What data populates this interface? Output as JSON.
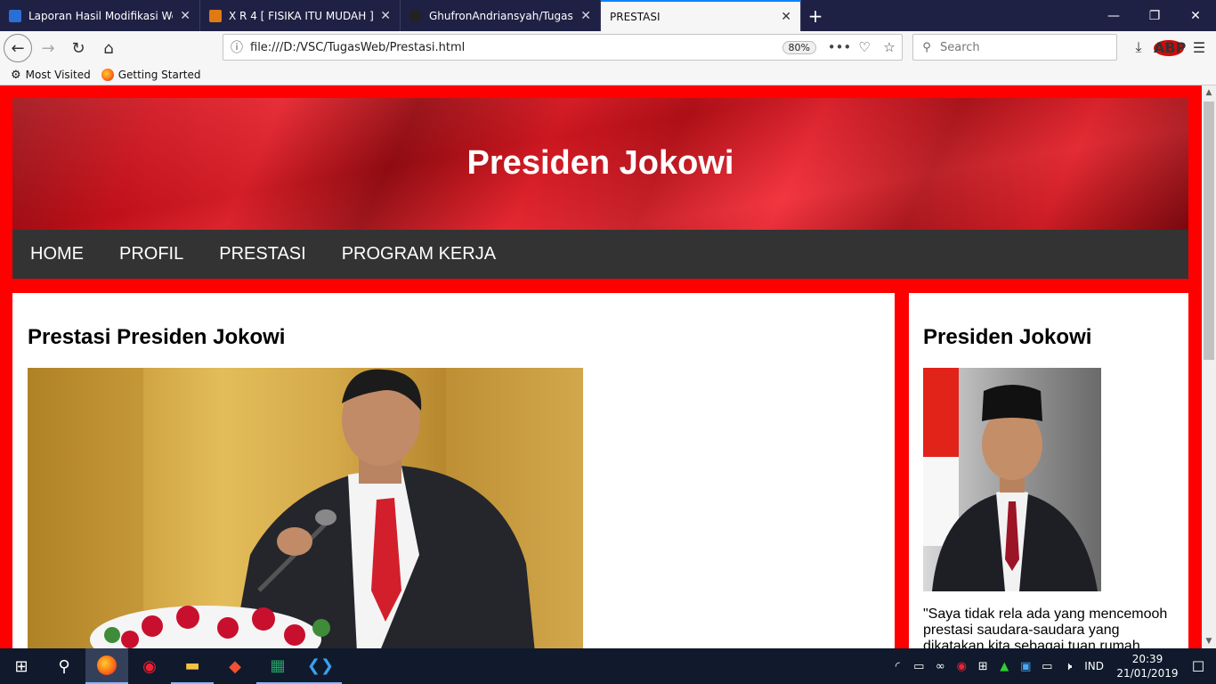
{
  "browser": {
    "tabs": [
      {
        "title": "Laporan Hasil Modifikasi Web",
        "favicon_color": "#2a6fd6"
      },
      {
        "title": "X R 4 [ FISIKA ITU MUDAH ]",
        "favicon_color": "#e07a12"
      },
      {
        "title": "GhufronAndriansyah/TugasMo",
        "favicon_color": "#222222"
      },
      {
        "title": "PRESTASI",
        "favicon_color": ""
      }
    ],
    "url": "file:///D:/VSC/TugasWeb/Prestasi.html",
    "zoom": "80%",
    "search_placeholder": "Search",
    "bookmarks": [
      {
        "label": "Most Visited",
        "icon": "gear-icon"
      },
      {
        "label": "Getting Started",
        "icon": "firefox-icon"
      }
    ],
    "abp_label": "ABP"
  },
  "page": {
    "header_title": "Presiden Jokowi",
    "nav": [
      "HOME",
      "PROFIL",
      "PRESTASI",
      "PROGRAM KERJA"
    ],
    "main_heading": "Prestasi Presiden Jokowi",
    "sidebar_heading": "Presiden Jokowi",
    "sidebar_quote": "\"Saya tidak rela ada yang mencemooh prestasi saudara-saudara yang dikatakan kita sebagai tuan rumah",
    "colors": {
      "page_bg": "#ff0000",
      "menu_bg": "#333333",
      "accent_tab": "#0a84ff"
    }
  },
  "taskbar": {
    "apps": [
      "firefox",
      "garena",
      "file-explorer",
      "git",
      "excel",
      "vscode"
    ],
    "language": "IND",
    "time": "20:39",
    "date": "21/01/2019"
  }
}
